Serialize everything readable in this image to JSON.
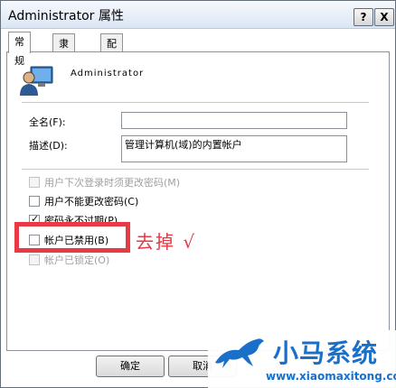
{
  "window": {
    "title": "Administrator 属性",
    "help": "?",
    "close": "X"
  },
  "tabs": [
    "常规",
    "隶属于",
    "配置文件"
  ],
  "user": {
    "name": "Administrator"
  },
  "form": {
    "fullname_label": "全名(F):",
    "fullname_value": "",
    "desc_label": "描述(D):",
    "desc_value": "管理计算机(域)的内置帐户"
  },
  "checkboxes": [
    {
      "label": "用户下次登录时须更改密码(M)",
      "checked": false,
      "enabled": false
    },
    {
      "label": "用户不能更改密码(C)",
      "checked": false,
      "enabled": true
    },
    {
      "label": "密码永不过期(P)",
      "checked": true,
      "enabled": true
    },
    {
      "label": "帐户已禁用(B)",
      "checked": false,
      "enabled": true
    },
    {
      "label": "帐户已锁定(O)",
      "checked": false,
      "enabled": false
    }
  ],
  "annotation": "去掉 √",
  "buttons": {
    "ok": "确定",
    "cancel": "取消"
  },
  "watermark": {
    "name": "小马系统",
    "url": "www.xiaomaxitong.com"
  },
  "colors": {
    "annotation": "#e23b46",
    "brand": "#1a6fc9"
  }
}
